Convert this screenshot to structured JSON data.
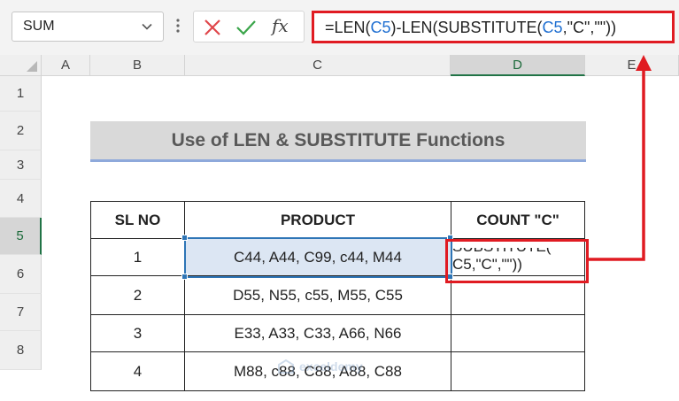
{
  "formula_bar": {
    "name_box": "SUM",
    "fx_label": "fx",
    "formula_parts": [
      "=LEN(",
      "C5",
      ")-LEN(SUBSTITUTE(",
      "C5",
      ",\"C\",\"\"))"
    ]
  },
  "columns": [
    "A",
    "B",
    "C",
    "D",
    "E"
  ],
  "rows": [
    "1",
    "2",
    "3",
    "4",
    "5",
    "6",
    "7",
    "8"
  ],
  "title": "Use of LEN & SUBSTITUTE Functions",
  "table": {
    "headers": [
      "SL NO",
      "PRODUCT",
      "COUNT \"C\""
    ],
    "rows": [
      {
        "sl": "1",
        "product": "C44, A44, C99, c44, M44"
      },
      {
        "sl": "2",
        "product": "D55, N55, c55, M55, C55"
      },
      {
        "sl": "3",
        "product": "E33, A33, C33, A66, N66"
      },
      {
        "sl": "4",
        "product": "M88, c88, C88, A88, C88"
      }
    ]
  },
  "edit_cell": {
    "line1": "SUBSTITUTE(",
    "line2": "C5,\"C\",\"\"))"
  },
  "watermark": "exceldemy",
  "colors": {
    "highlight": "#e01b22",
    "ref_blue": "#1f6fd1",
    "selection": "#2e75b6",
    "title_bg": "#d9d9d9",
    "title_underline": "#8ea9db"
  }
}
